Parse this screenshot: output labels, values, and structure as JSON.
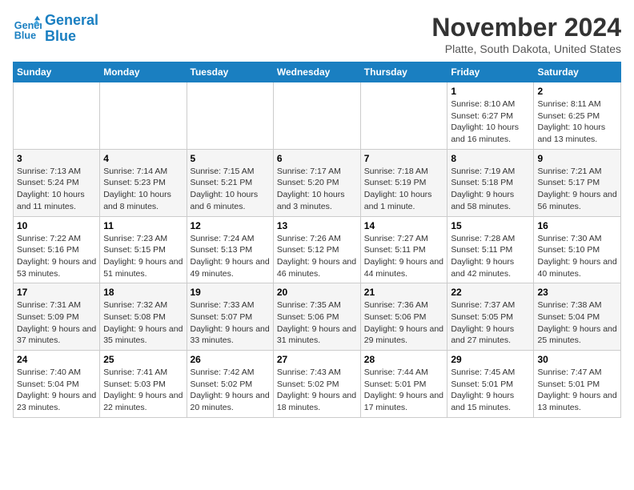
{
  "logo": {
    "line1": "General",
    "line2": "Blue"
  },
  "title": "November 2024",
  "location": "Platte, South Dakota, United States",
  "days_of_week": [
    "Sunday",
    "Monday",
    "Tuesday",
    "Wednesday",
    "Thursday",
    "Friday",
    "Saturday"
  ],
  "weeks": [
    [
      {
        "day": "",
        "info": ""
      },
      {
        "day": "",
        "info": ""
      },
      {
        "day": "",
        "info": ""
      },
      {
        "day": "",
        "info": ""
      },
      {
        "day": "",
        "info": ""
      },
      {
        "day": "1",
        "info": "Sunrise: 8:10 AM\nSunset: 6:27 PM\nDaylight: 10 hours and 16 minutes."
      },
      {
        "day": "2",
        "info": "Sunrise: 8:11 AM\nSunset: 6:25 PM\nDaylight: 10 hours and 13 minutes."
      }
    ],
    [
      {
        "day": "3",
        "info": "Sunrise: 7:13 AM\nSunset: 5:24 PM\nDaylight: 10 hours and 11 minutes."
      },
      {
        "day": "4",
        "info": "Sunrise: 7:14 AM\nSunset: 5:23 PM\nDaylight: 10 hours and 8 minutes."
      },
      {
        "day": "5",
        "info": "Sunrise: 7:15 AM\nSunset: 5:21 PM\nDaylight: 10 hours and 6 minutes."
      },
      {
        "day": "6",
        "info": "Sunrise: 7:17 AM\nSunset: 5:20 PM\nDaylight: 10 hours and 3 minutes."
      },
      {
        "day": "7",
        "info": "Sunrise: 7:18 AM\nSunset: 5:19 PM\nDaylight: 10 hours and 1 minute."
      },
      {
        "day": "8",
        "info": "Sunrise: 7:19 AM\nSunset: 5:18 PM\nDaylight: 9 hours and 58 minutes."
      },
      {
        "day": "9",
        "info": "Sunrise: 7:21 AM\nSunset: 5:17 PM\nDaylight: 9 hours and 56 minutes."
      }
    ],
    [
      {
        "day": "10",
        "info": "Sunrise: 7:22 AM\nSunset: 5:16 PM\nDaylight: 9 hours and 53 minutes."
      },
      {
        "day": "11",
        "info": "Sunrise: 7:23 AM\nSunset: 5:15 PM\nDaylight: 9 hours and 51 minutes."
      },
      {
        "day": "12",
        "info": "Sunrise: 7:24 AM\nSunset: 5:13 PM\nDaylight: 9 hours and 49 minutes."
      },
      {
        "day": "13",
        "info": "Sunrise: 7:26 AM\nSunset: 5:12 PM\nDaylight: 9 hours and 46 minutes."
      },
      {
        "day": "14",
        "info": "Sunrise: 7:27 AM\nSunset: 5:11 PM\nDaylight: 9 hours and 44 minutes."
      },
      {
        "day": "15",
        "info": "Sunrise: 7:28 AM\nSunset: 5:11 PM\nDaylight: 9 hours and 42 minutes."
      },
      {
        "day": "16",
        "info": "Sunrise: 7:30 AM\nSunset: 5:10 PM\nDaylight: 9 hours and 40 minutes."
      }
    ],
    [
      {
        "day": "17",
        "info": "Sunrise: 7:31 AM\nSunset: 5:09 PM\nDaylight: 9 hours and 37 minutes."
      },
      {
        "day": "18",
        "info": "Sunrise: 7:32 AM\nSunset: 5:08 PM\nDaylight: 9 hours and 35 minutes."
      },
      {
        "day": "19",
        "info": "Sunrise: 7:33 AM\nSunset: 5:07 PM\nDaylight: 9 hours and 33 minutes."
      },
      {
        "day": "20",
        "info": "Sunrise: 7:35 AM\nSunset: 5:06 PM\nDaylight: 9 hours and 31 minutes."
      },
      {
        "day": "21",
        "info": "Sunrise: 7:36 AM\nSunset: 5:06 PM\nDaylight: 9 hours and 29 minutes."
      },
      {
        "day": "22",
        "info": "Sunrise: 7:37 AM\nSunset: 5:05 PM\nDaylight: 9 hours and 27 minutes."
      },
      {
        "day": "23",
        "info": "Sunrise: 7:38 AM\nSunset: 5:04 PM\nDaylight: 9 hours and 25 minutes."
      }
    ],
    [
      {
        "day": "24",
        "info": "Sunrise: 7:40 AM\nSunset: 5:04 PM\nDaylight: 9 hours and 23 minutes."
      },
      {
        "day": "25",
        "info": "Sunrise: 7:41 AM\nSunset: 5:03 PM\nDaylight: 9 hours and 22 minutes."
      },
      {
        "day": "26",
        "info": "Sunrise: 7:42 AM\nSunset: 5:02 PM\nDaylight: 9 hours and 20 minutes."
      },
      {
        "day": "27",
        "info": "Sunrise: 7:43 AM\nSunset: 5:02 PM\nDaylight: 9 hours and 18 minutes."
      },
      {
        "day": "28",
        "info": "Sunrise: 7:44 AM\nSunset: 5:01 PM\nDaylight: 9 hours and 17 minutes."
      },
      {
        "day": "29",
        "info": "Sunrise: 7:45 AM\nSunset: 5:01 PM\nDaylight: 9 hours and 15 minutes."
      },
      {
        "day": "30",
        "info": "Sunrise: 7:47 AM\nSunset: 5:01 PM\nDaylight: 9 hours and 13 minutes."
      }
    ]
  ]
}
